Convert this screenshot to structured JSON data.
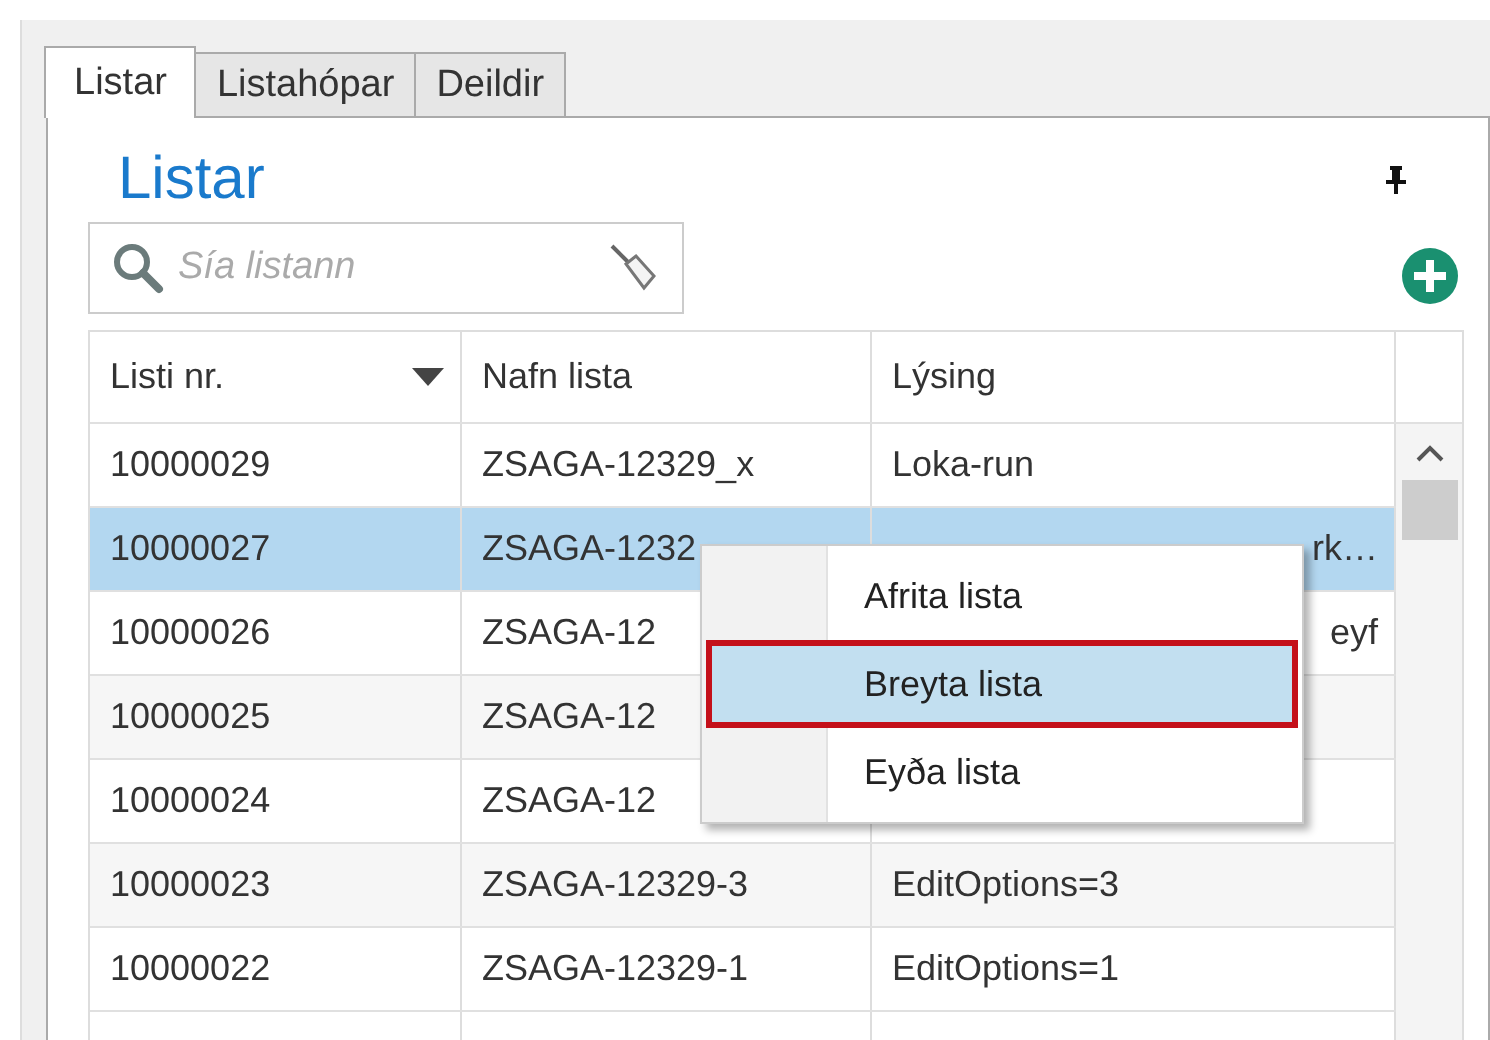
{
  "tabs": [
    {
      "label": "Listar",
      "selected": true
    },
    {
      "label": "Listahópar",
      "selected": false
    },
    {
      "label": "Deildir",
      "selected": false
    }
  ],
  "panel": {
    "title": "Listar"
  },
  "search": {
    "placeholder": "Sía listann"
  },
  "table": {
    "columns": [
      {
        "label": "Listi nr.",
        "sorted": true
      },
      {
        "label": "Nafn lista",
        "sorted": false
      },
      {
        "label": "Lýsing",
        "sorted": false
      }
    ],
    "rows": [
      {
        "selected": false,
        "cells": [
          {
            "text": "10000029"
          },
          {
            "text": "ZSAGA-12329_x"
          },
          {
            "text": "Loka-run"
          }
        ]
      },
      {
        "selected": true,
        "cells": [
          {
            "text": "10000027"
          },
          {
            "text": "ZSAGA-1232"
          },
          {
            "text": "rk…",
            "start_hidden": true
          }
        ]
      },
      {
        "selected": false,
        "cells": [
          {
            "text": "10000026"
          },
          {
            "text": "ZSAGA-12"
          },
          {
            "text": "eyf",
            "start_hidden": true
          }
        ]
      },
      {
        "selected": false,
        "cells": [
          {
            "text": "10000025"
          },
          {
            "text": "ZSAGA-12"
          },
          {
            "text": ""
          }
        ]
      },
      {
        "selected": false,
        "cells": [
          {
            "text": "10000024"
          },
          {
            "text": "ZSAGA-12"
          },
          {
            "text": ""
          }
        ]
      },
      {
        "selected": false,
        "cells": [
          {
            "text": "10000023"
          },
          {
            "text": "ZSAGA-12329-3"
          },
          {
            "text": "EditOptions=3"
          }
        ]
      },
      {
        "selected": false,
        "cells": [
          {
            "text": "10000022"
          },
          {
            "text": "ZSAGA-12329-1"
          },
          {
            "text": "EditOptions=1"
          }
        ]
      }
    ]
  },
  "context_menu": {
    "items": [
      {
        "label": "Afrita lista",
        "selected": false
      },
      {
        "label": "Breyta lista",
        "selected": true
      },
      {
        "label": "Eyða lista",
        "selected": false
      }
    ]
  }
}
